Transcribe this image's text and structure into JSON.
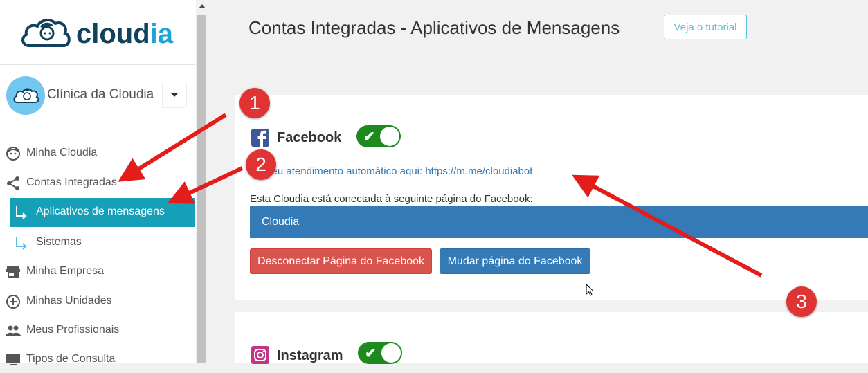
{
  "brand": {
    "logo_text_main": "cloud",
    "logo_text_accent": "ia"
  },
  "account": {
    "clinic_name": "Clínica da Cloudia"
  },
  "sidebar": {
    "items": [
      {
        "label": "Minha Cloudia",
        "icon": "face-icon"
      },
      {
        "label": "Contas Integradas",
        "icon": "share-icon"
      },
      {
        "label": "Aplicativos de mensagens",
        "icon": "sub-arrow-icon",
        "active": true
      },
      {
        "label": "Sistemas",
        "icon": "sub-arrow-icon"
      },
      {
        "label": "Minha Empresa",
        "icon": "store-icon"
      },
      {
        "label": "Minhas Unidades",
        "icon": "add-circle-icon"
      },
      {
        "label": "Meus Profissionais",
        "icon": "people-icon"
      },
      {
        "label": "Tipos de Consulta",
        "icon": "computer-icon"
      }
    ]
  },
  "header": {
    "title": "Contas Integradas - Aplicativos de Mensagens",
    "tutorial_button": "Veja o tutorial"
  },
  "facebook": {
    "name": "Facebook",
    "enabled": true,
    "link_text": "e o seu atendimento automático aqui: https://m.me/cloudiabot",
    "connected_text": "Esta Cloudia está conectada à seguinte página do Facebook:",
    "page_name": "Cloudia",
    "disconnect_button": "Desconectar Página do Facebook",
    "change_button": "Mudar página do Facebook"
  },
  "instagram": {
    "name": "Instagram",
    "enabled": true
  },
  "annotations": {
    "badge_1": "1",
    "badge_2": "2",
    "badge_3": "3"
  },
  "colors": {
    "active_nav": "#15a0b8",
    "primary": "#337ab7",
    "danger": "#d9534f",
    "toggle_on": "#1e8a1e",
    "annotation_red": "#e03434"
  }
}
